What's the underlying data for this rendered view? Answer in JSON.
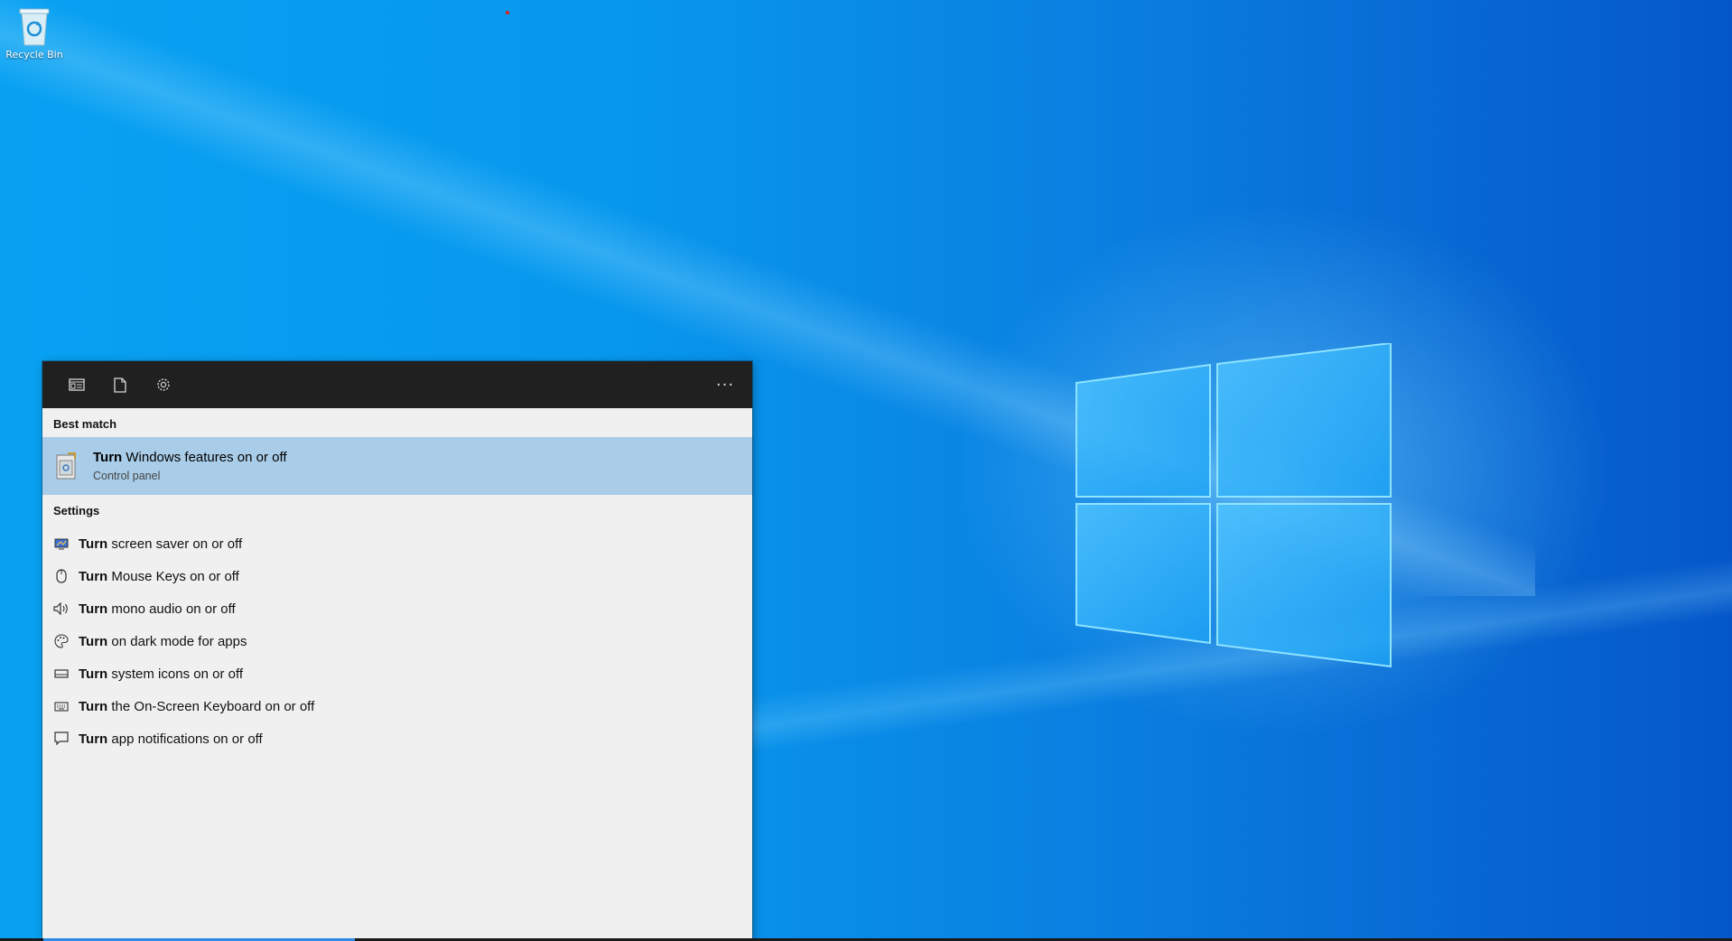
{
  "desktop": {
    "recycle_bin_label": "Recycle Bin"
  },
  "search_panel": {
    "toolbar": {
      "icons": [
        "apps-scope-icon",
        "documents-scope-icon",
        "settings-scope-icon"
      ],
      "more_label": "···"
    },
    "best_match": {
      "heading": "Best match",
      "keyword": "Turn",
      "title_rest": " Windows features on or off",
      "subtitle": "Control panel",
      "highlight_color": "#a9cde8"
    },
    "settings": {
      "heading": "Settings",
      "items": [
        {
          "keyword": "Turn",
          "rest": " screen saver on or off",
          "icon": "screen-saver-icon"
        },
        {
          "keyword": "Turn",
          "rest": " Mouse Keys on or off",
          "icon": "mouse-icon"
        },
        {
          "keyword": "Turn",
          "rest": " mono audio on or off",
          "icon": "speaker-icon"
        },
        {
          "keyword": "Turn",
          "rest": " on dark mode for apps",
          "icon": "palette-icon"
        },
        {
          "keyword": "Turn",
          "rest": " system icons on or off",
          "icon": "taskbar-icon"
        },
        {
          "keyword": "Turn",
          "rest": " the On-Screen Keyboard on or off",
          "icon": "keyboard-icon"
        },
        {
          "keyword": "Turn",
          "rest": " app notifications on or off",
          "icon": "notification-icon"
        }
      ]
    }
  }
}
